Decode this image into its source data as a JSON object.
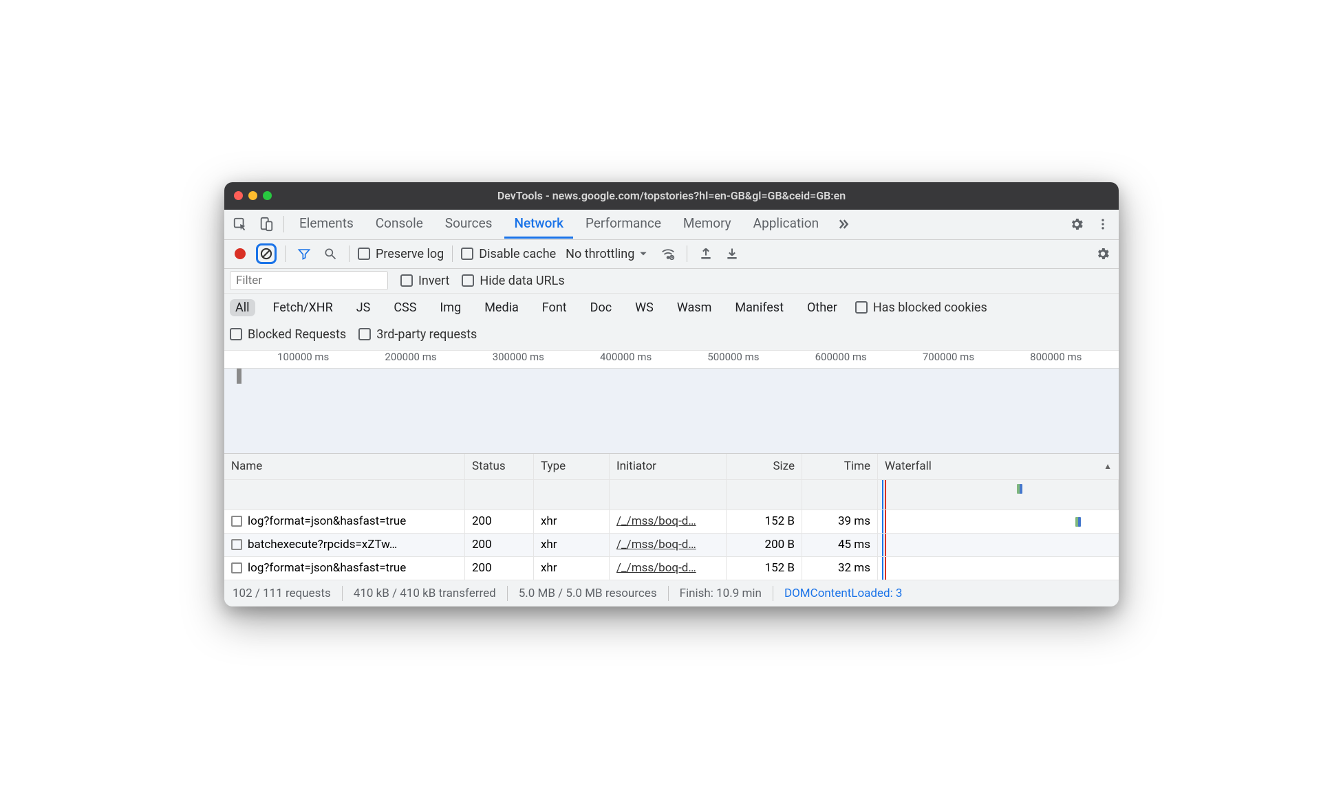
{
  "window": {
    "title": "DevTools - news.google.com/topstories?hl=en-GB&gl=GB&ceid=GB:en"
  },
  "tabs": {
    "elements": "Elements",
    "console": "Console",
    "sources": "Sources",
    "network": "Network",
    "performance": "Performance",
    "memory": "Memory",
    "application": "Application"
  },
  "toolbar": {
    "preserve_log": "Preserve log",
    "disable_cache": "Disable cache",
    "throttling": "No throttling"
  },
  "filter": {
    "placeholder": "Filter",
    "invert": "Invert",
    "hide_data_urls": "Hide data URLs"
  },
  "types": {
    "all": "All",
    "fetch": "Fetch/XHR",
    "js": "JS",
    "css": "CSS",
    "img": "Img",
    "media": "Media",
    "font": "Font",
    "doc": "Doc",
    "ws": "WS",
    "wasm": "Wasm",
    "manifest": "Manifest",
    "other": "Other",
    "has_blocked_cookies": "Has blocked cookies",
    "blocked_requests": "Blocked Requests",
    "third_party": "3rd-party requests"
  },
  "timeline": {
    "ticks": [
      "100000 ms",
      "200000 ms",
      "300000 ms",
      "400000 ms",
      "500000 ms",
      "600000 ms",
      "700000 ms",
      "800000 ms"
    ]
  },
  "columns": {
    "name": "Name",
    "status": "Status",
    "type": "Type",
    "initiator": "Initiator",
    "size": "Size",
    "time": "Time",
    "waterfall": "Waterfall"
  },
  "rows": [
    {
      "name": "log?format=json&hasfast=true",
      "status": "200",
      "type": "xhr",
      "initiator": "/_/mss/boq-d…",
      "size": "152 B",
      "time": "39 ms"
    },
    {
      "name": "batchexecute?rpcids=xZTw…",
      "status": "200",
      "type": "xhr",
      "initiator": "/_/mss/boq-d…",
      "size": "200 B",
      "time": "45 ms"
    },
    {
      "name": "log?format=json&hasfast=true",
      "status": "200",
      "type": "xhr",
      "initiator": "/_/mss/boq-d…",
      "size": "152 B",
      "time": "32 ms"
    }
  ],
  "status": {
    "requests": "102 / 111 requests",
    "transferred": "410 kB / 410 kB transferred",
    "resources": "5.0 MB / 5.0 MB resources",
    "finish": "Finish: 10.9 min",
    "dcl": "DOMContentLoaded: 3"
  }
}
